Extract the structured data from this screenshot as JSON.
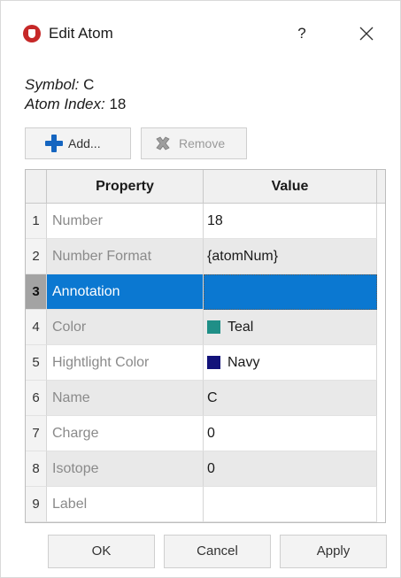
{
  "dialog": {
    "title": "Edit Atom",
    "help_label": "?"
  },
  "info": {
    "symbol_label": "Symbol:",
    "symbol_value": "C",
    "index_label": "Atom Index:",
    "index_value": "18"
  },
  "toolbar": {
    "add_label": "Add...",
    "remove_label": "Remove"
  },
  "table": {
    "headers": [
      "Property",
      "Value"
    ],
    "rows": [
      {
        "num": "1",
        "property": "Number",
        "value": "18"
      },
      {
        "num": "2",
        "property": "Number Format",
        "value": "{atomNum}"
      },
      {
        "num": "3",
        "property": "Annotation",
        "value": ""
      },
      {
        "num": "4",
        "property": "Color",
        "value": "Teal",
        "swatch": "#1f8f87"
      },
      {
        "num": "5",
        "property": "Hightlight Color",
        "value": "Navy",
        "swatch": "#12127a"
      },
      {
        "num": "6",
        "property": "Name",
        "value": "C"
      },
      {
        "num": "7",
        "property": "Charge",
        "value": "0"
      },
      {
        "num": "8",
        "property": "Isotope",
        "value": "0"
      },
      {
        "num": "9",
        "property": "Label",
        "value": ""
      }
    ]
  },
  "footer": {
    "ok_label": "OK",
    "cancel_label": "Cancel",
    "apply_label": "Apply"
  },
  "colors": {
    "selection": "#0b78d1",
    "app_icon": "#c62828",
    "add_icon": "#1565c0"
  },
  "icons": [
    "app-icon",
    "help-icon",
    "close-icon",
    "plus-icon",
    "remove-x-icon"
  ]
}
